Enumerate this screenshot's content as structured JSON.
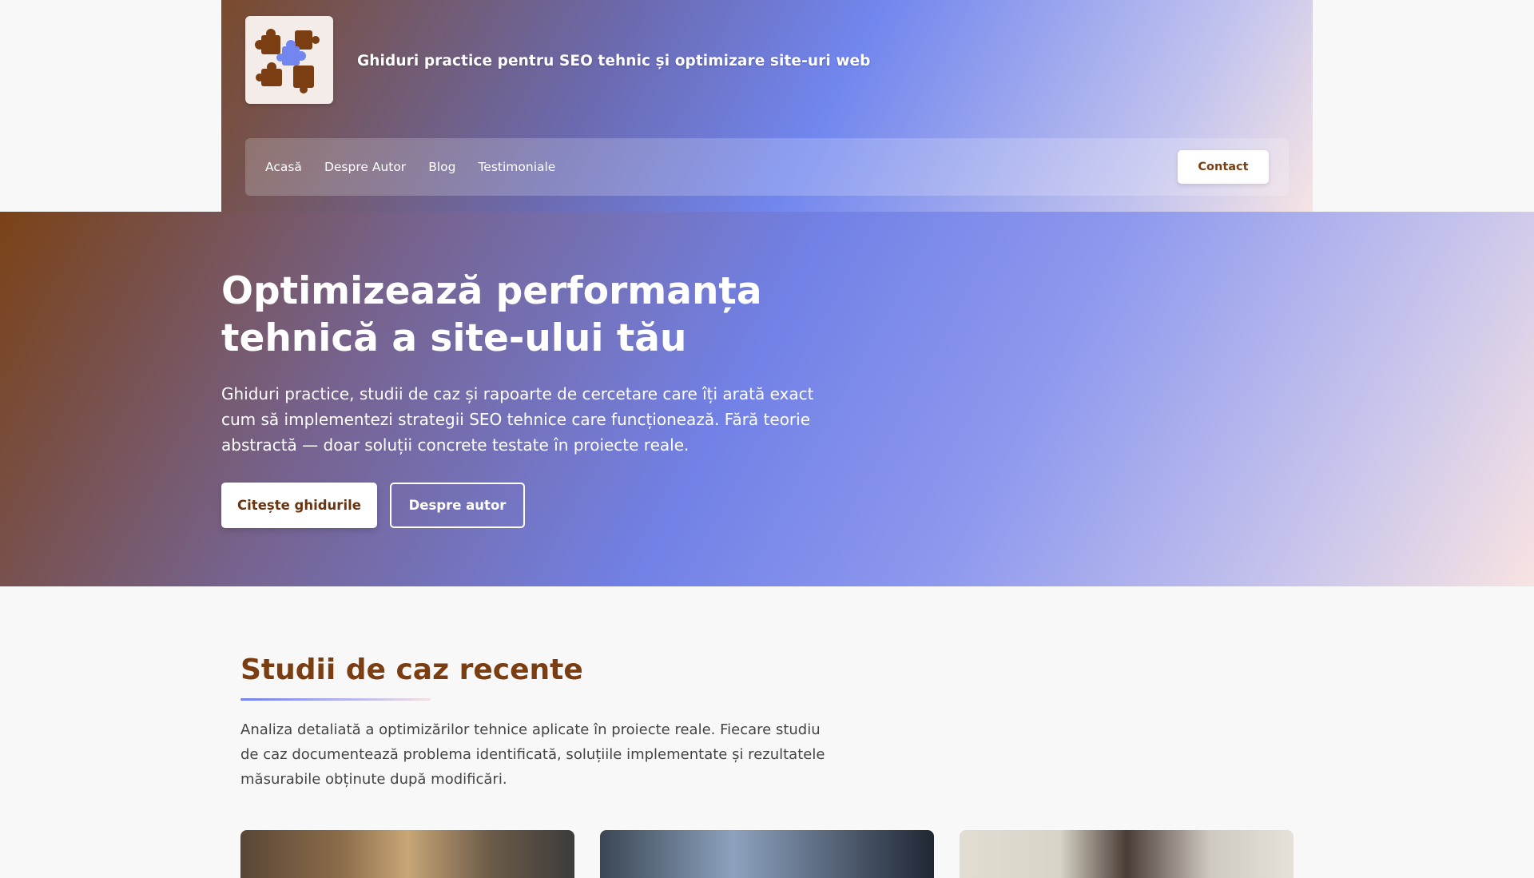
{
  "header": {
    "logo_icon": "puzzle-pieces-icon",
    "tagline": "Ghiduri practice pentru SEO tehnic și optimizare site-uri web",
    "nav": [
      {
        "label": "Acasă"
      },
      {
        "label": "Despre Autor"
      },
      {
        "label": "Blog"
      },
      {
        "label": "Testimoniale"
      }
    ],
    "contact_label": "Contact"
  },
  "hero": {
    "title": "Optimizează performanța tehnică a site-ului tău",
    "subtitle": "Ghiduri practice, studii de caz și rapoarte de cercetare care îți arată exact cum să implementezi strategii SEO tehnice care funcționează. Fără teorie abstractă — doar soluții concrete testate în proiecte reale.",
    "primary_button": "Citește ghidurile",
    "secondary_button": "Despre autor"
  },
  "case_studies": {
    "title": "Studii de caz recente",
    "description": "Analiza detaliată a optimizărilor tehnice aplicate în proiecte reale. Fiecare studiu de caz documentează problema identificată, soluțiile implementate și rezultatele măsurabile obținute după modificări."
  },
  "colors": {
    "brand_brown": "#7a3e12",
    "accent_blue": "#7186ee",
    "accent_pink": "#f6e4e4"
  }
}
